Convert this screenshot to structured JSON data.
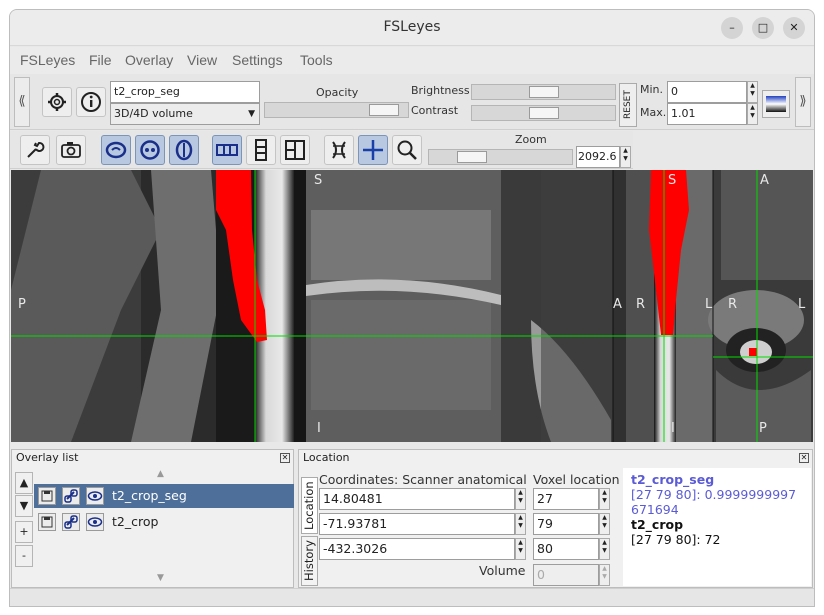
{
  "window": {
    "title": "FSLeyes",
    "min_label": "–",
    "max_label": "□",
    "close_label": "✕"
  },
  "menubar": [
    "FSLeyes",
    "File",
    "Overlay",
    "View",
    "Settings",
    "Tools"
  ],
  "overlay_toolbar": {
    "overlay_name": "t2_crop_seg",
    "overlay_type": "3D/4D volume",
    "opacity_label": "Opacity",
    "opacity": 0.92,
    "brightness_label": "Brightness",
    "brightness": 0.5,
    "contrast_label": "Contrast",
    "contrast": 0.5,
    "reset_label": "RESET",
    "min_label": "Min.",
    "min_value": "0",
    "max_label": "Max.",
    "max_value": "1.01",
    "left_grip": "⟪",
    "right_grip": "⟫"
  },
  "view_toolbar": {
    "zoom_label": "Zoom",
    "zoom_value": "2092.6",
    "zoom": 0.25
  },
  "orientation": {
    "sagittal": {
      "top": "S",
      "bottom": "I",
      "left": "P",
      "right": "A"
    },
    "coronal": {
      "top": "S",
      "bottom": "I",
      "left": "R",
      "right": "L"
    },
    "axial": {
      "top": "A",
      "bottom": "P",
      "left": "R",
      "right": "L"
    }
  },
  "overlay_list": {
    "title": "Overlay list",
    "close": "✕",
    "items": [
      {
        "name": "t2_crop_seg",
        "selected": true
      },
      {
        "name": "t2_crop",
        "selected": false
      }
    ],
    "up_arrow": "▲",
    "down_arrow": "▼",
    "add": "+",
    "remove": "-",
    "scroll_up": "▲",
    "scroll_down": "▼"
  },
  "location": {
    "title": "Location",
    "close": "✕",
    "tab_location": "Location",
    "tab_history": "History",
    "coords_header": "Coordinates: Scanner anatomical",
    "voxel_header": "Voxel location",
    "coords": [
      "14.80481",
      "-71.93781",
      "-432.3026"
    ],
    "voxels": [
      "27",
      "79",
      "80"
    ],
    "volume_label": "Volume",
    "volume_value": "0",
    "info": [
      {
        "name": "t2_crop_seg",
        "value": "[27 79 80]: 0.9999999997671694",
        "color": "#5b5bd6"
      },
      {
        "name": "t2_crop",
        "value": "[27 79 80]: 72",
        "color": "#111111"
      }
    ]
  },
  "colors": {
    "accent": "#4d6f9a",
    "crosshair": "#00dd00",
    "segmentation": "#ff0000"
  }
}
